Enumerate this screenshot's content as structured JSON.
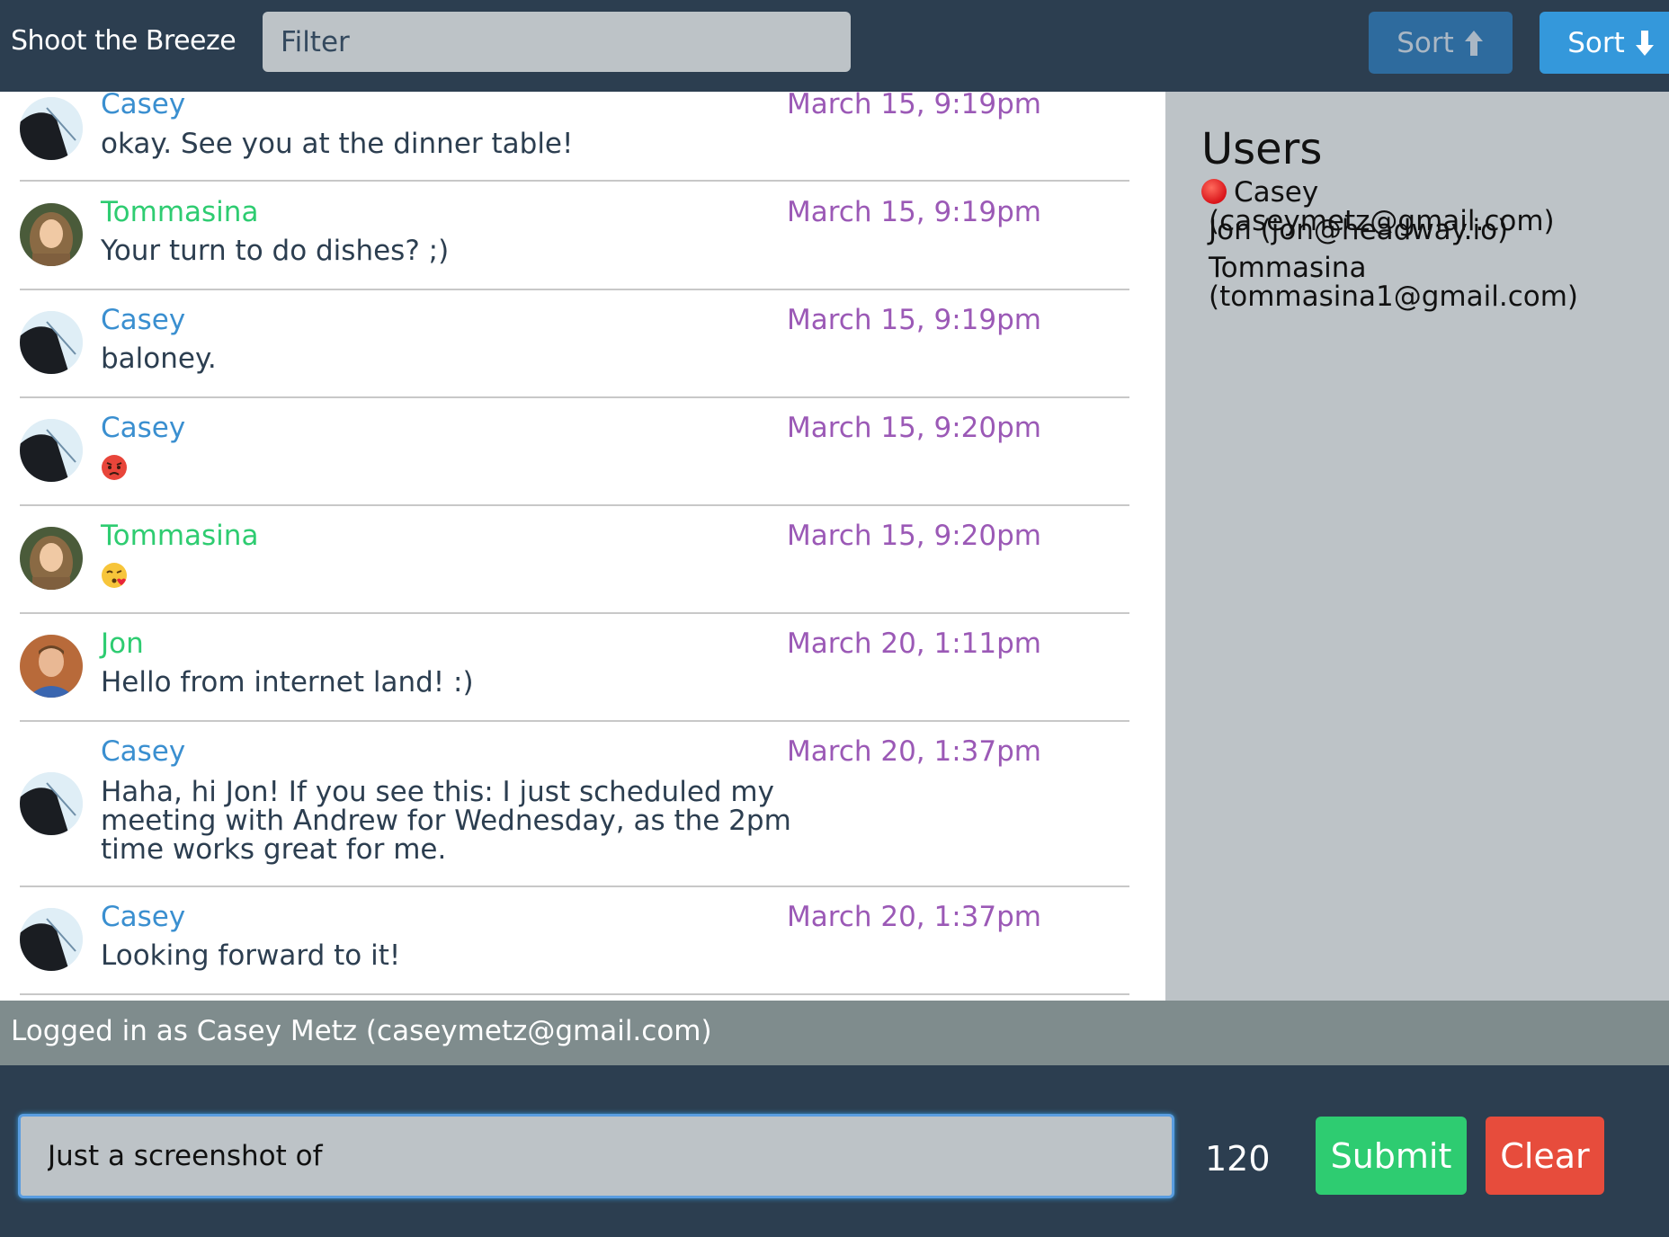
{
  "app": {
    "title": "Shoot the Breeze"
  },
  "header": {
    "filter_placeholder": "Filter",
    "sort_up_label": "Sort",
    "sort_up_icon": "arrow-up-icon",
    "sort_down_label": "Sort",
    "sort_down_icon": "arrow-down-icon"
  },
  "messages": [
    {
      "author": "Casey",
      "time": "March 15, 9:19pm",
      "text": "okay. See you at the dinner table!",
      "avatar": "casey-avatar"
    },
    {
      "author": "Tommasina",
      "time": "March 15, 9:19pm",
      "text": "Your turn to do dishes? ;)",
      "avatar": "tommasina-avatar"
    },
    {
      "author": "Casey",
      "time": "March 15, 9:19pm",
      "text": "baloney.",
      "avatar": "casey-avatar"
    },
    {
      "author": "Casey",
      "time": "March 15, 9:20pm",
      "text": "",
      "emoji": "angry-face-emoji",
      "avatar": "casey-avatar"
    },
    {
      "author": "Tommasina",
      "time": "March 15, 9:20pm",
      "text": "",
      "emoji": "kissing-face-emoji",
      "avatar": "tommasina-avatar"
    },
    {
      "author": "Jon",
      "time": "March 20, 1:11pm",
      "text": "Hello from internet land! :)",
      "avatar": "jon-avatar"
    },
    {
      "author": "Casey",
      "time": "March 20, 1:37pm",
      "text": "Haha, hi Jon! If you see this: I just scheduled my meeting with Andrew for Wednesday, as the 2pm time works great for me.",
      "avatar": "casey-avatar"
    },
    {
      "author": "Casey",
      "time": "March 20, 1:37pm",
      "text": "Looking forward to it!",
      "avatar": "casey-avatar"
    }
  ],
  "users_panel": {
    "title": "Users",
    "users": [
      {
        "label": "Casey (caseymetz@gmail.com)",
        "status": "red-dot"
      },
      {
        "label": "Jon (jon@headway.io)"
      },
      {
        "label": "Tommasina (tommasina1@gmail.com)"
      }
    ]
  },
  "status_bar": {
    "text": "Logged in as Casey Metz (caseymetz@gmail.com)"
  },
  "compose": {
    "value": "Just a screenshot of",
    "char_count": "120",
    "submit_label": "Submit",
    "clear_label": "Clear"
  },
  "colors": {
    "navy": "#2c3e50",
    "blue": "#3498db",
    "green": "#2ecc71",
    "red": "#e74c3c",
    "purple": "#9b59b6",
    "silver": "#bdc3c7",
    "gray": "#7f8c8d"
  }
}
